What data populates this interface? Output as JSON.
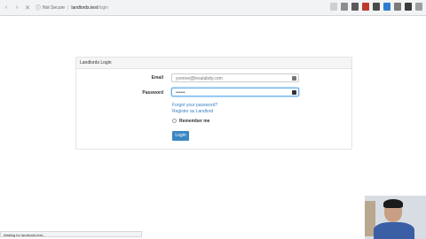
{
  "browser": {
    "back": "‹",
    "forward": "›",
    "reload": "✕",
    "security": "Not Secure",
    "host": "landlords.test",
    "path": "/login"
  },
  "panel": {
    "title": "Landlords Login",
    "email_label": "Email",
    "email_value": "yvonne@lesalabdy.com",
    "password_label": "Password",
    "password_value": "••••••",
    "forgot_link": "Forgot your password?",
    "register_link": "Register as Landlord",
    "remember_label": "Remember me",
    "login_button": "Login"
  },
  "status_bar": {
    "text": "Waiting for landlords.test..."
  }
}
